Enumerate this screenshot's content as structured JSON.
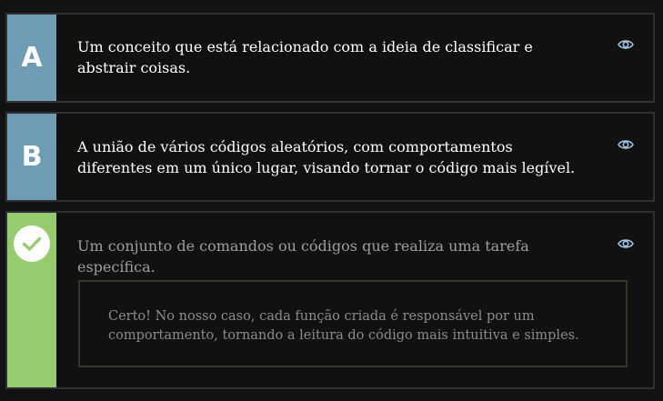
{
  "options": [
    {
      "badge": "A",
      "text": "Um conceito que está relacionado com a ideia de classificar e abstrair coisas.",
      "state": "default"
    },
    {
      "badge": "B",
      "text": "A união de vários códigos aleatórios, com comportamentos diferentes em um único lugar, visando tornar o código mais legível.",
      "state": "default"
    },
    {
      "badge": "check-icon",
      "text": "Um conjunto de comandos ou códigos que realiza uma tarefa específica.",
      "state": "correct",
      "feedback": "Certo! No nosso caso, cada função criada é responsável por um comportamento, tornando a leitura do código mais intuitiva e simples."
    }
  ],
  "colors": {
    "background": "#111213",
    "badge_default": "#6e9cb4",
    "badge_correct": "#96cc6f",
    "eye_icon": "#9fc4e0"
  }
}
